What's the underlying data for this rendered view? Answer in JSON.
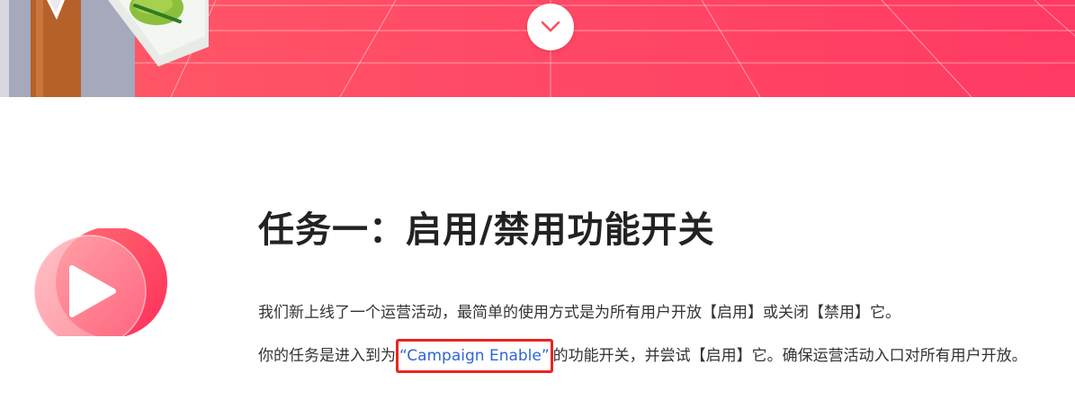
{
  "hero": {
    "scroll_icon": "chevron-down-icon",
    "colors": {
      "start": "#ff5a66",
      "end": "#ff3a63"
    }
  },
  "task": {
    "title": "任务一：启用/禁用功能开关",
    "paragraph1": "我们新上线了一个运营活动，最简单的使用方式是为所有用户开放【启用】或关闭【禁用】它。",
    "paragraph2_before": "你的任务是进入到为",
    "link_text": "“Campaign Enable”",
    "paragraph2_after": "的功能开关，并尝试【启用】它。确保运营活动入口对所有用户开放。"
  },
  "colors": {
    "link": "#2f66d6",
    "highlight_box": "#e8251f",
    "play_badge": "#ff3d5e"
  },
  "icons": {
    "play": "play-icon"
  }
}
